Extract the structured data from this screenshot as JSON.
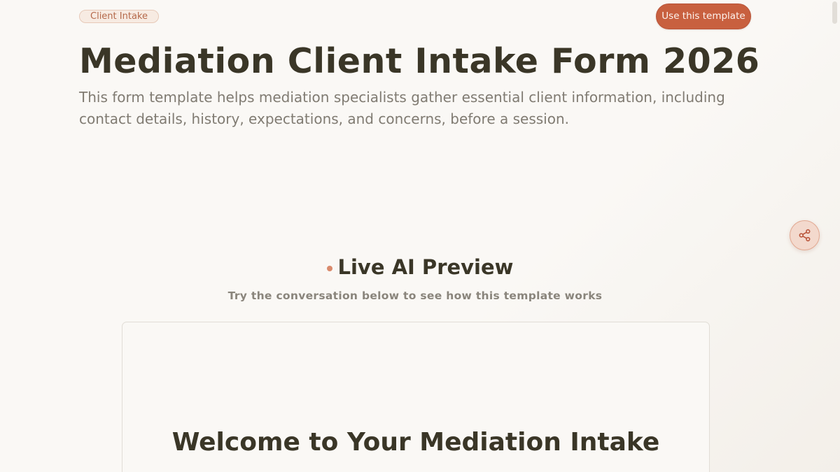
{
  "header": {
    "tag": "Client Intake",
    "cta_label": "Use this template"
  },
  "hero": {
    "title": "Mediation Client Intake Form 2026",
    "subtitle": "This form template helps mediation specialists gather essential client information, including contact details, history, expectations, and concerns, before a session."
  },
  "preview": {
    "title": "Live AI Preview",
    "caption": "Try the conversation below to see how this template works",
    "card_heading": "Welcome to Your Mediation Intake"
  },
  "icons": {
    "share": "share-icon"
  },
  "colors": {
    "accent": "#c8603f",
    "accent_soft": "#f3d9cd",
    "text_dark": "#3a3627",
    "text_muted": "#807b72",
    "background": "#faf8f5"
  }
}
